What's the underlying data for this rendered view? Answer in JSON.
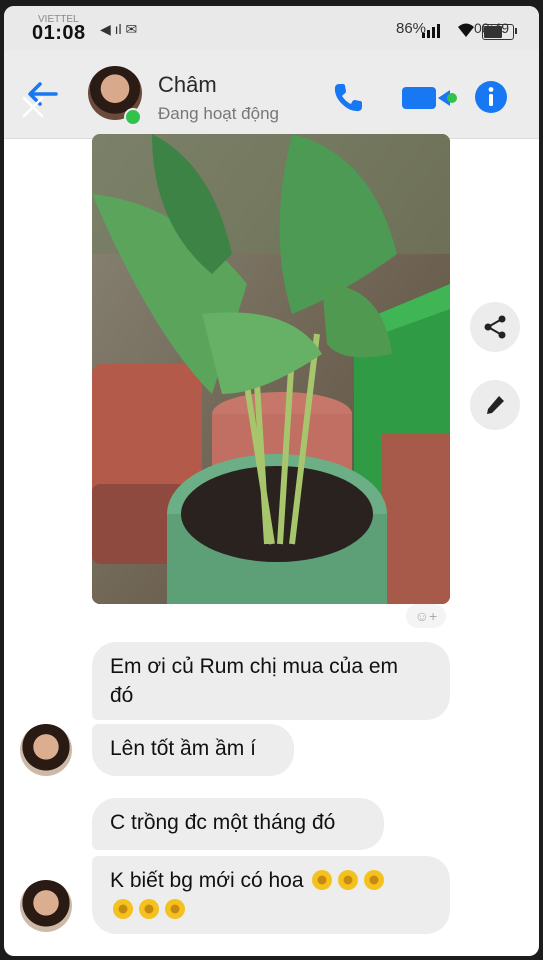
{
  "status_bar": {
    "time": "01:08",
    "carrier": "VIETTEL",
    "left_icons": "◀ ıl ✉",
    "battery_percent": "86%",
    "right_time": "08:49",
    "battery_level": 0.86
  },
  "header": {
    "contact_name": "Châm",
    "presence": "Đang hoạt động",
    "icons": [
      "back-arrow-icon",
      "close-icon",
      "phone-icon",
      "video-camera-icon",
      "info-icon"
    ],
    "accent_color": "#1877f2",
    "online_color": "#31c24c"
  },
  "photo": {
    "description_icons": [
      "share-icon",
      "edit-pencil-icon",
      "add-reaction-icon"
    ],
    "reaction_hint": "☺+"
  },
  "messages": [
    {
      "text_line1": "Em ơi củ Rum chị mua của em",
      "text_line2": "đó"
    },
    {
      "text": "Lên tốt ầm ầm í"
    },
    {
      "text": "C trồng đc một tháng đó"
    },
    {
      "text": "K biết bg mới có hoa",
      "emoji": [
        "sunflower",
        "sunflower",
        "sunflower",
        "sunflower",
        "sunflower",
        "sunflower"
      ]
    }
  ]
}
